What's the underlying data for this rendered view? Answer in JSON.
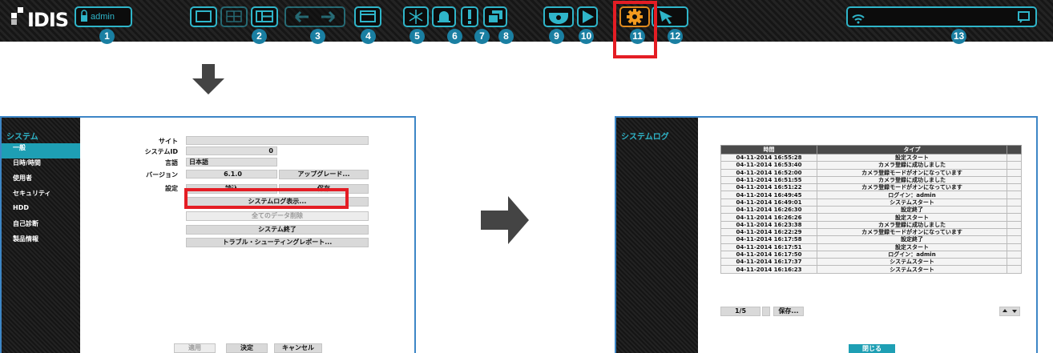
{
  "toolbar": {
    "logo_text": "IDIS",
    "user_label": "admin",
    "numbers": [
      "1",
      "2",
      "3",
      "4",
      "5",
      "6",
      "7",
      "8",
      "9",
      "10",
      "11",
      "12",
      "13"
    ],
    "icons": [
      "lock-icon",
      "single-layout-icon",
      "quad-layout-icon",
      "split-layout-icon",
      "prev-arrow-icon",
      "next-arrow-icon",
      "sequence-icon",
      "freeze-icon",
      "alarm-bell-icon",
      "alert-icon",
      "group-icon",
      "ptz-camera-icon",
      "play-icon",
      "setup-gear-icon",
      "quick-action-icon",
      "network-icon",
      "chat-icon"
    ]
  },
  "left_panel": {
    "sidebar_title": "システム",
    "sidebar_items": [
      "一般",
      "日時/時間",
      "使用者",
      "セキュリティ",
      "HDD",
      "自己診断",
      "製品情報"
    ],
    "labels": {
      "site": "サイト",
      "system_id": "システムID",
      "language": "言語",
      "version": "バージョン",
      "settings": "設定"
    },
    "values": {
      "site": "",
      "system_id": "0",
      "language": "日本語",
      "version": "6.1.0"
    },
    "buttons": {
      "upgrade": "アップグレード...",
      "load": "読込",
      "save": "保存",
      "show_log": "システムログ表示...",
      "clear_data": "全てのデータ削除",
      "shutdown": "システム終了",
      "troubleshoot": "トラブル・シューティングレポート...",
      "apply": "適用",
      "ok": "決定",
      "cancel": "キャンセル"
    }
  },
  "right_panel": {
    "sidebar_title": "システムログ",
    "columns": [
      "時間",
      "タイプ"
    ],
    "rows": [
      [
        "04-11-2014 16:55:28",
        "設定スタート"
      ],
      [
        "04-11-2014 16:53:40",
        "カメラ登録に成功しました"
      ],
      [
        "04-11-2014 16:52:00",
        "カメラ登録モードがオンになっています"
      ],
      [
        "04-11-2014 16:51:55",
        "カメラ登録に成功しました"
      ],
      [
        "04-11-2014 16:51:22",
        "カメラ登録モードがオンになっています"
      ],
      [
        "04-11-2014 16:49:45",
        "ログイン：admin"
      ],
      [
        "04-11-2014 16:49:01",
        "システムスタート"
      ],
      [
        "04-11-2014 16:26:30",
        "設定終了"
      ],
      [
        "04-11-2014 16:26:26",
        "設定スタート"
      ],
      [
        "04-11-2014 16:23:38",
        "カメラ登録に成功しました"
      ],
      [
        "04-11-2014 16:22:29",
        "カメラ登録モードがオンになっています"
      ],
      [
        "04-11-2014 16:17:58",
        "設定終了"
      ],
      [
        "04-11-2014 16:17:51",
        "設定スタート"
      ],
      [
        "04-11-2014 16:17:50",
        "ログイン：admin"
      ],
      [
        "04-11-2014 16:17:37",
        "システムスタート"
      ],
      [
        "04-11-2014 16:16:23",
        "システムスタート"
      ]
    ],
    "page": "1/5",
    "save_label": "保存...",
    "close_label": "閉じる"
  },
  "colors": {
    "accent": "#2fb5c9",
    "highlight": "#e41d24",
    "number_badge": "#1a7fa2",
    "panel_border": "#3d86c6"
  }
}
